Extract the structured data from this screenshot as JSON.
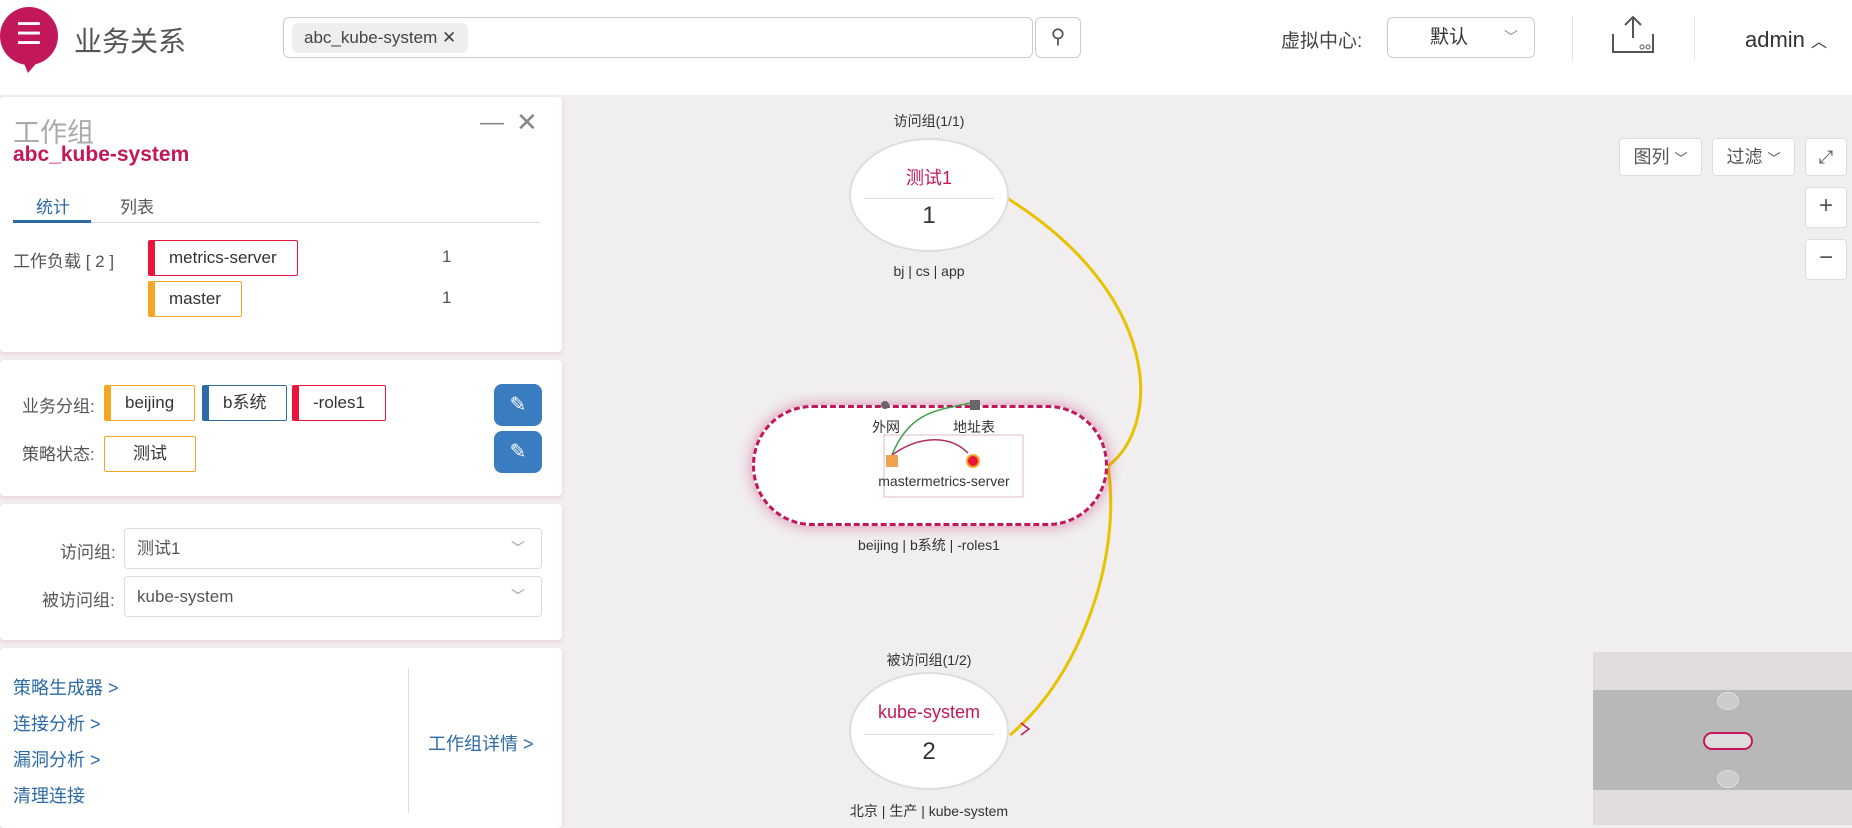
{
  "header": {
    "title": "业务关系",
    "search_chip": "abc_kube-system",
    "vc_label": "虚拟中心:",
    "vc_value": "默认",
    "user": "admin"
  },
  "panel": {
    "type": "工作组",
    "name": "abc_kube-system",
    "tabs": [
      "统计",
      "列表"
    ],
    "workload_label": "工作负载 [ 2 ]",
    "workloads": [
      {
        "name": "metrics-server",
        "count": "1",
        "color": "#e8173a"
      },
      {
        "name": "master",
        "count": "1",
        "color": "#f5a623"
      }
    ],
    "biz_group_label": "业务分组:",
    "biz_tags": [
      {
        "name": "beijing",
        "color": "#f5a623"
      },
      {
        "name": "b系统",
        "color": "#2d6aa6"
      },
      {
        "name": "-roles1",
        "color": "#e8173a"
      }
    ],
    "policy_label": "策略状态:",
    "policy_value": "测试",
    "visit_label": "访问组:",
    "visit_value": "测试1",
    "visited_label": "被访问组:",
    "visited_value": "kube-system",
    "links": [
      "策略生成器 >",
      "连接分析 >",
      "漏洞分析 >",
      "清理连接"
    ],
    "detail_link": "工作组详情 >"
  },
  "canvas": {
    "legend": "图列",
    "filter": "过滤",
    "top_node": {
      "caption": "访问组(1/1)",
      "name": "测试1",
      "count": "1",
      "tags": "bj | cs | app"
    },
    "mid_node": {
      "ext1": "外网",
      "ext2": "地址表",
      "wl": "mastermetrics-server",
      "tags": "beijing | b系统 | -roles1"
    },
    "bottom_node": {
      "caption": "被访问组(1/2)",
      "name": "kube-system",
      "count": "2",
      "tags": "北京 | 生产 | kube-system"
    }
  }
}
